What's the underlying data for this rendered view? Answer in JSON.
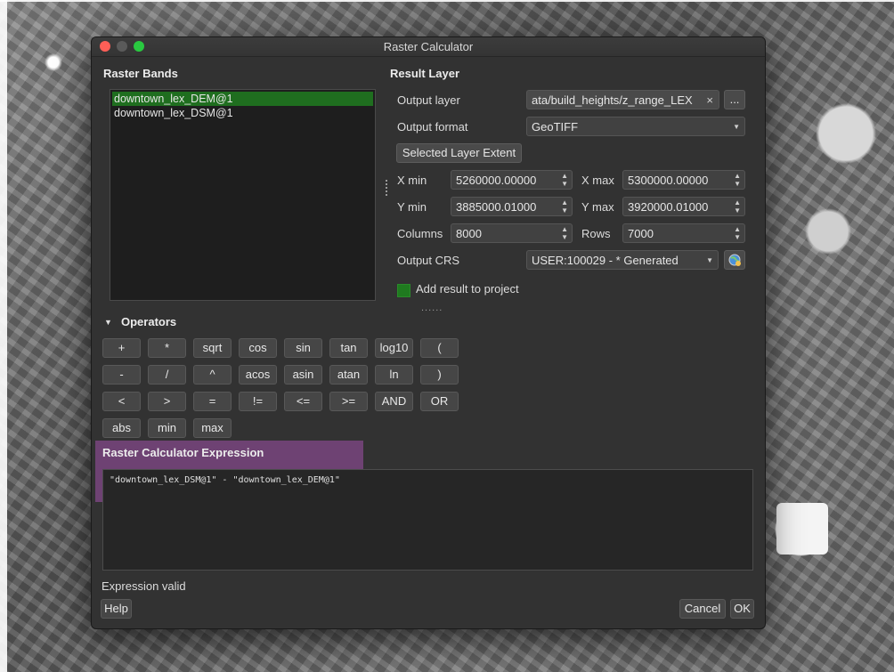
{
  "window": {
    "title": "Raster Calculator"
  },
  "raster_bands": {
    "heading": "Raster Bands",
    "items": [
      "downtown_lex_DEM@1",
      "downtown_lex_DSM@1"
    ],
    "selected_index": 0
  },
  "result_layer": {
    "heading": "Result Layer",
    "output_layer_label": "Output layer",
    "output_layer_value": "ata/build_heights/z_range_LEX",
    "clear_icon": "×",
    "browse_label": "...",
    "output_format_label": "Output format",
    "output_format_value": "GeoTIFF",
    "selected_extent_label": "Selected Layer Extent",
    "xmin_label": "X min",
    "xmin_value": "5260000.00000",
    "xmax_label": "X max",
    "xmax_value": "5300000.00000",
    "ymin_label": "Y min",
    "ymin_value": "3885000.01000",
    "ymax_label": "Y max",
    "ymax_value": "3920000.01000",
    "columns_label": "Columns",
    "columns_value": "8000",
    "rows_label": "Rows",
    "rows_value": "7000",
    "crs_label": "Output CRS",
    "crs_value": "USER:100029 -  * Generated",
    "add_to_project_label": "Add result to project",
    "add_to_project_checked": true,
    "extra_dots": "......"
  },
  "operators": {
    "heading": "Operators",
    "rows": [
      [
        "+",
        "*",
        "sqrt",
        "cos",
        "sin",
        "tan",
        "log10",
        "("
      ],
      [
        "-",
        "/",
        "^",
        "acos",
        "asin",
        "atan",
        "ln",
        ")"
      ],
      [
        "<",
        ">",
        "=",
        "!=",
        "<=",
        ">=",
        "AND",
        "OR"
      ],
      [
        "abs",
        "min",
        "max"
      ]
    ]
  },
  "expression": {
    "heading": "Raster Calculator Expression",
    "value": "\"downtown_lex_DSM@1\" - \"downtown_lex_DEM@1\"",
    "status": "Expression valid"
  },
  "footer": {
    "help": "Help",
    "cancel": "Cancel",
    "ok": "OK"
  },
  "colors": {
    "accent_green": "#1f6e1f",
    "highlight": "#a050aa"
  }
}
